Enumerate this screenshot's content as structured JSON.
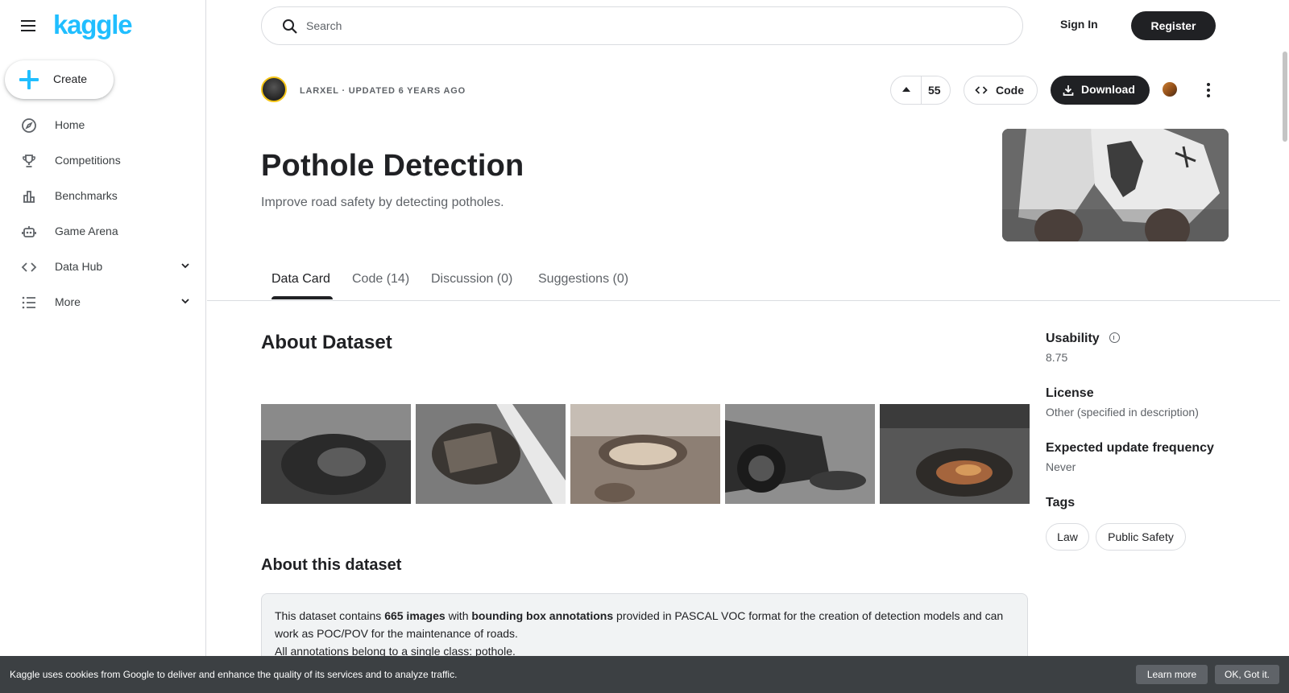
{
  "brand": {
    "logo_text": "kaggle",
    "accent_color": "#20beff"
  },
  "sidebar": {
    "create_label": "Create",
    "items": [
      {
        "label": "Home",
        "icon": "compass-icon"
      },
      {
        "label": "Competitions",
        "icon": "trophy-icon"
      },
      {
        "label": "Benchmarks",
        "icon": "bar-chart-icon"
      },
      {
        "label": "Game Arena",
        "icon": "robot-icon"
      },
      {
        "label": "Data Hub",
        "icon": "code-icon",
        "expandable": true
      },
      {
        "label": "More",
        "icon": "list-icon",
        "expandable": true
      }
    ]
  },
  "header": {
    "search_placeholder": "Search",
    "sign_in": "Sign In",
    "register": "Register"
  },
  "dataset": {
    "meta": "LARXEL · UPDATED 6 YEARS AGO",
    "votes": "55",
    "code_label": "Code",
    "download_label": "Download",
    "title": "Pothole Detection",
    "subtitle": "Improve road safety by detecting potholes."
  },
  "tabs": [
    {
      "label": "Data Card",
      "active": true
    },
    {
      "label": "Code (14)",
      "active": false
    },
    {
      "label": "Discussion (0)",
      "active": false
    },
    {
      "label": "Suggestions (0)",
      "active": false
    }
  ],
  "content": {
    "about_heading": "About Dataset",
    "about_this_heading": "About this dataset",
    "desc_part1": "This dataset contains ",
    "desc_bold1": "665 images",
    "desc_part2": " with ",
    "desc_bold2": "bounding box annotations",
    "desc_part3": " provided in PASCAL VOC format for the creation of detection models and can work as POC/POV for the maintenance of roads.",
    "desc_line2": "All annotations belong to a single class: pothole."
  },
  "right_panel": {
    "usability_label": "Usability",
    "usability_value": "8.75",
    "license_label": "License",
    "license_value": "Other (specified in description)",
    "frequency_label": "Expected update frequency",
    "frequency_value": "Never",
    "tags_label": "Tags",
    "tags": [
      "Law",
      "Public Safety"
    ]
  },
  "cookie": {
    "text": "Kaggle uses cookies from Google to deliver and enhance the quality of its services and to analyze traffic.",
    "learn_more": "Learn more",
    "ok": "OK, Got it."
  }
}
